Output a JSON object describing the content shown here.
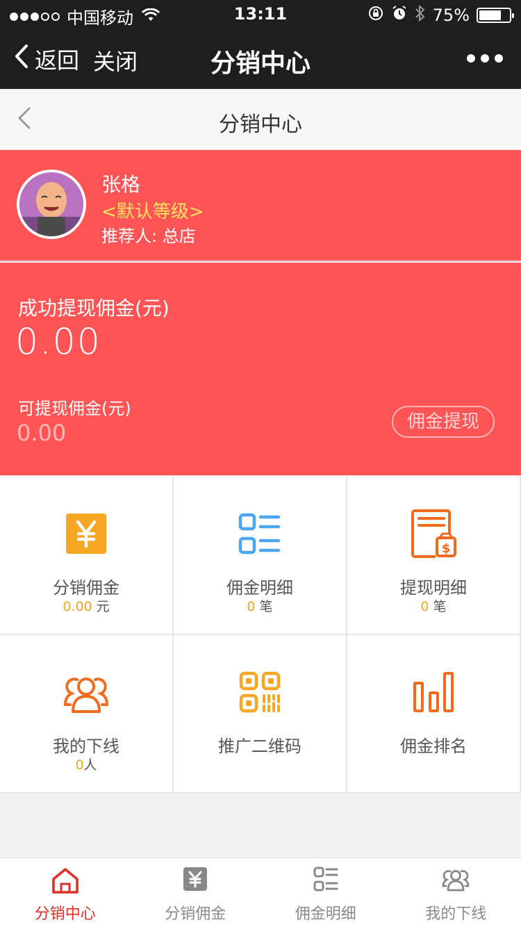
{
  "status_bar": {
    "carrier": "中国移动",
    "time": "13:11",
    "battery": "75%",
    "battery_level": 0.75
  },
  "wechat_nav": {
    "back_label": "返回",
    "close_label": "关闭",
    "title": "分销中心"
  },
  "header": {
    "title": "分销中心"
  },
  "profile": {
    "name": "张格",
    "level": "<默认等级>",
    "referrer": "推荐人: 总店"
  },
  "commission": {
    "withdrawn_label": "成功提现佣金(元)",
    "withdrawn_value": "0.00",
    "available_label": "可提现佣金(元)",
    "available_value": "0.00",
    "withdraw_button": "佣金提现"
  },
  "grid": {
    "items": [
      {
        "label": "分销佣金",
        "value": "0.00",
        "unit": " 元",
        "icon": "yen-icon"
      },
      {
        "label": "佣金明细",
        "value": "0",
        "unit": " 笔",
        "icon": "list-icon"
      },
      {
        "label": "提现明细",
        "value": "0",
        "unit": " 笔",
        "icon": "withdraw-record-icon"
      },
      {
        "label": "我的下线",
        "value": "0",
        "unit": "人",
        "icon": "team-icon"
      },
      {
        "label": "推广二维码",
        "icon": "qrcode-icon"
      },
      {
        "label": "佣金排名",
        "icon": "ranking-icon"
      }
    ]
  },
  "tabs": [
    {
      "label": "分销中心",
      "icon": "home-icon"
    },
    {
      "label": "分销佣金",
      "icon": "yen-icon"
    },
    {
      "label": "佣金明细",
      "icon": "list-icon"
    },
    {
      "label": "我的下线",
      "icon": "team-icon"
    }
  ],
  "colors": {
    "primary": "#fe5455",
    "orange": "#f6a623",
    "blue": "#4aa8f2",
    "deep_orange": "#f26b1d",
    "active_tab": "#e02e24"
  }
}
